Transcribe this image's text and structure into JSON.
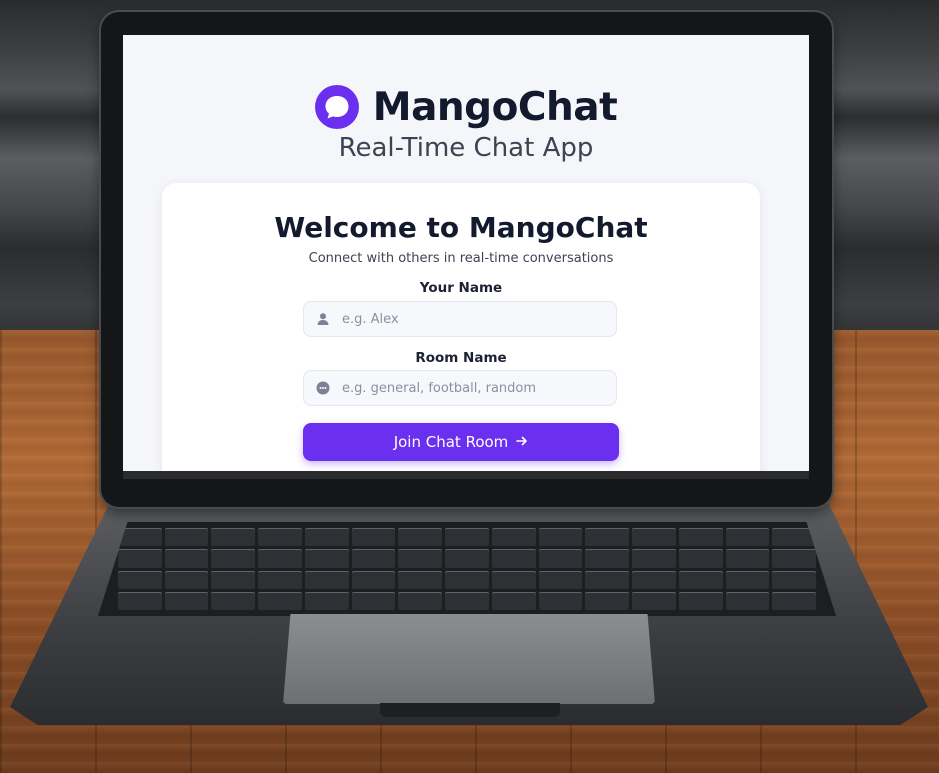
{
  "brand": {
    "name": "MangoChat",
    "tagline": "Real-Time Chat App",
    "accent_color": "#6b2ff0",
    "logo_icon": "chat-bubble-icon"
  },
  "card": {
    "title": "Welcome to MangoChat",
    "subtitle": "Connect with others in real-time conversations",
    "name_field": {
      "label": "Your Name",
      "placeholder": "e.g. Alex",
      "value": "",
      "icon": "user-icon"
    },
    "room_field": {
      "label": "Room Name",
      "placeholder": "e.g. general, football, random",
      "value": "",
      "icon": "chat-dots-icon"
    },
    "join_button": {
      "label": "Join Chat Room",
      "icon": "arrow-right-icon"
    }
  }
}
